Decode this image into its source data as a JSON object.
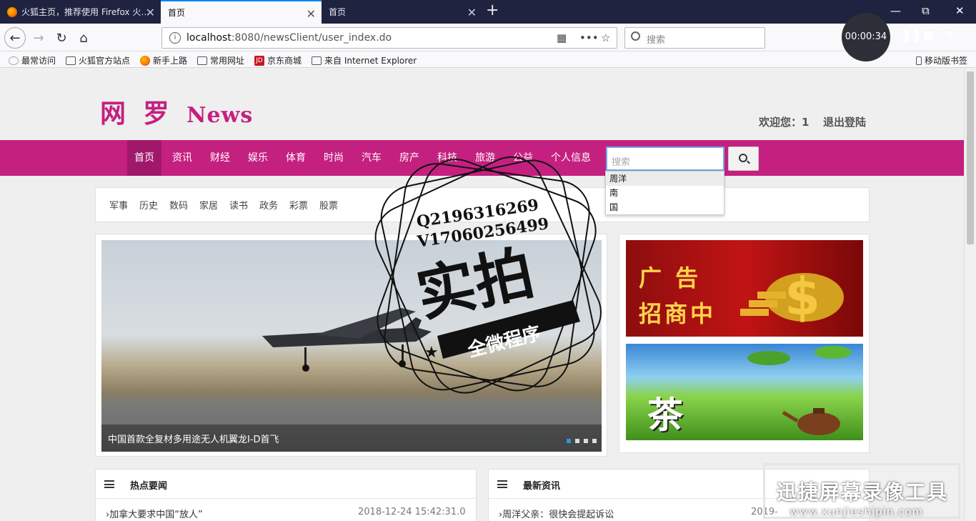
{
  "tabs": [
    {
      "label": "火狐主页，推荐使用 Firefox 火…"
    },
    {
      "label": "首页"
    },
    {
      "label": "首页"
    }
  ],
  "window_controls": {
    "minimize": "—",
    "restore": "⧉",
    "close": "✕"
  },
  "address": {
    "host": "localhost",
    "path": ":8080/newsClient/user_index.do"
  },
  "browser_search": {
    "placeholder": "搜索"
  },
  "bookmarks": [
    "最常访问",
    "火狐官方站点",
    "新手上路",
    "常用网址",
    "京东商城",
    "来自 Internet Explorer"
  ],
  "bookmarks_right": "移动版书签",
  "recorder": {
    "time": "00:00:34"
  },
  "site": {
    "logo_cn": "网 罗",
    "logo_en": "News",
    "welcome": "欢迎您：1",
    "logout": "退出登陆"
  },
  "menu": [
    "首页",
    "资讯",
    "财经",
    "娱乐",
    "体育",
    "时尚",
    "汽车",
    "房产",
    "科技",
    "旅游",
    "公益",
    "个人信息"
  ],
  "search": {
    "placeholder": "搜索"
  },
  "suggestions": [
    "周洋",
    "南",
    "国"
  ],
  "subnav": [
    "军事",
    "历史",
    "数码",
    "家居",
    "读书",
    "政务",
    "彩票",
    "股票"
  ],
  "carousel": {
    "caption": "中国首款全复材多用途无人机翼龙I-D首飞",
    "slides": 4,
    "active": 1
  },
  "ads": [
    {
      "text_line1": "广 告",
      "text_line2": "招商中"
    },
    {
      "text": "茶"
    }
  ],
  "hot_news": {
    "title": "热点要闻",
    "rows": [
      {
        "text": "加拿大要求中国“放人”",
        "time": "2018-12-24 15:42:31.0"
      }
    ]
  },
  "latest_news": {
    "title": "最新资讯",
    "rows": [
      {
        "text": "周洋父亲：很快会提起诉讼",
        "time": "2019-"
      }
    ]
  },
  "stamp": {
    "line1": "Q2196316269",
    "line2": "V17060256499",
    "main": "实拍",
    "ribbon": "全微程序"
  },
  "recorder_watermark": {
    "title": "迅捷屏幕录像工具",
    "url": "www.xunjieshipin.com"
  },
  "colors": {
    "brand": "#c4207f",
    "brand_dark": "#a0186a",
    "tabbar": "#1f2340",
    "accent": "#0a84ff"
  }
}
